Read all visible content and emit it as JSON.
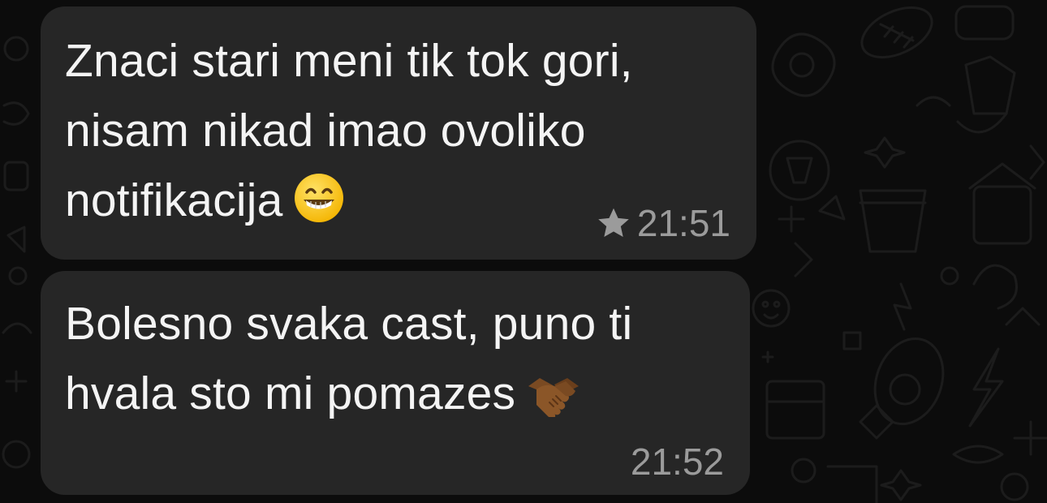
{
  "messages": [
    {
      "lines": [
        "Znaci stari meni tik tok gori,",
        "nisam nikad imao ovoliko",
        "notifikacija"
      ],
      "emoji": "grinning-face-icon",
      "time": "21:51",
      "starred": true
    },
    {
      "lines": [
        "Bolesno svaka cast, puno ti",
        "hvala sto mi pomazes"
      ],
      "emoji": "handshake-icon",
      "time": "21:52",
      "starred": false
    }
  ],
  "colors": {
    "background": "#0c0c0c",
    "bubble": "#262626",
    "text": "#f4f4f4",
    "meta": "#9b9b9b"
  }
}
